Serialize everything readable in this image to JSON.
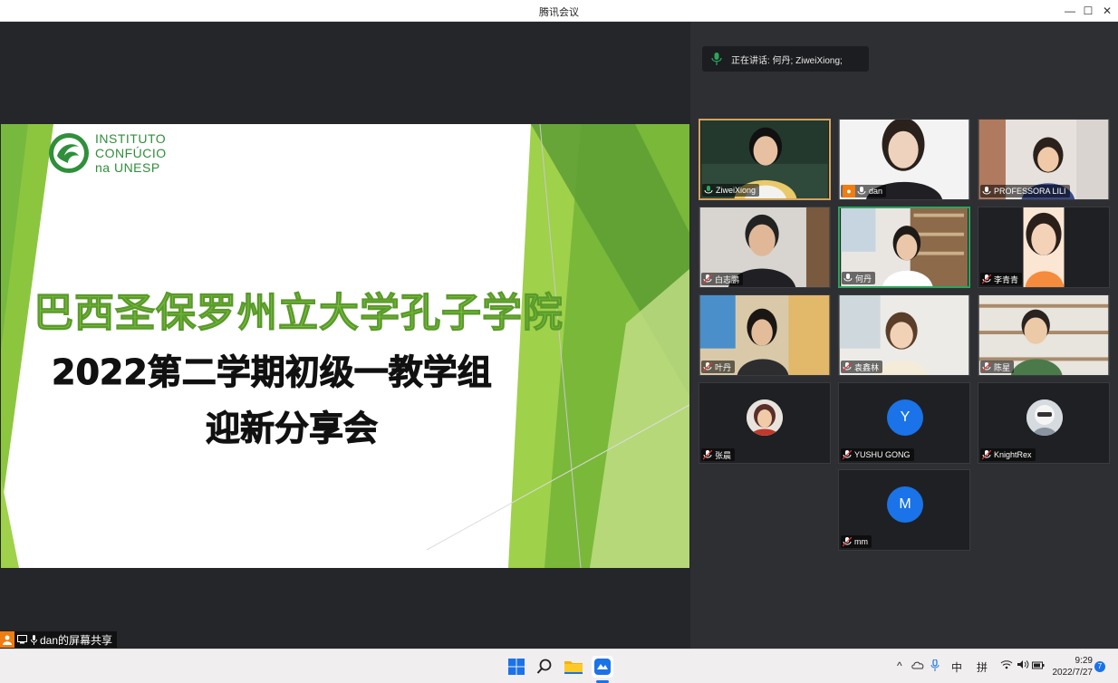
{
  "window": {
    "title": "腾讯会议",
    "minimize": "—",
    "maximize": "☐",
    "close": "✕"
  },
  "slide": {
    "logo_lines": [
      "INSTITUTO",
      "CONFÚCIO",
      "na  UNESP"
    ],
    "line1": "巴西圣保罗州立大学孔子学院",
    "line2": "2022第二学期初级一教学组",
    "line3": "迎新分享会"
  },
  "sharer": {
    "label": "dan的屏幕共享"
  },
  "speaking": {
    "label": "正在讲话: 何丹; ZiweiXiong;"
  },
  "participants": [
    {
      "name": "ZiweiXiong"
    },
    {
      "name": "dan"
    },
    {
      "name": "PROFESSORA  LILI"
    },
    {
      "name": "白志鹏"
    },
    {
      "name": "何丹"
    },
    {
      "name": "李青青"
    },
    {
      "name": "叶丹"
    },
    {
      "name": "袁鑫林"
    },
    {
      "name": "陈星"
    },
    {
      "name": "张晨"
    },
    {
      "name": "YUSHU GONG",
      "initial": "Y"
    },
    {
      "name": "KnightRex"
    },
    {
      "name": "mm",
      "initial": "M"
    }
  ],
  "taskbar": {
    "ime_lang": "中",
    "ime_mode": "拼",
    "time": "9:29",
    "date": "2022/7/27",
    "notifications": "7"
  },
  "colors": {
    "accent_green": "#7ac142",
    "speaking_green": "#2ca55c",
    "avatar_blue": "#1a73e8",
    "share_orange": "#f07c12"
  }
}
